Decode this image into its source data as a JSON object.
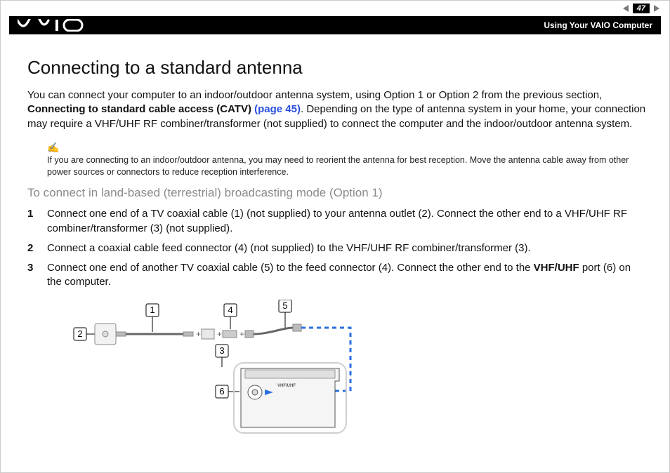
{
  "header": {
    "section": "Using Your VAIO Computer",
    "page_number": "47"
  },
  "nav": {
    "prev_icon": "triangle-left",
    "next_icon": "triangle-right"
  },
  "title": "Connecting to a standard antenna",
  "intro": {
    "t1": "You can connect your computer to an indoor/outdoor antenna system, using Option 1 or Option 2 from the previous section, ",
    "bold": "Connecting to standard cable access (CATV) ",
    "link": "(page 45)",
    "t2": ". Depending on the type of antenna system in your home, your connection may require a VHF/UHF RF combiner/transformer (not supplied) to connect the computer and the indoor/outdoor antenna system."
  },
  "note": {
    "icon": "pen-icon",
    "text": "If you are connecting to an indoor/outdoor antenna, you may need to reorient the antenna for best reception. Move the antenna cable away from other power sources or connectors to reduce reception interference."
  },
  "subheading": "To connect in land-based (terrestrial) broadcasting mode (Option 1)",
  "steps": [
    {
      "n": "1",
      "text": "Connect one end of a TV coaxial cable (1) (not supplied) to your antenna outlet (2). Connect the other end to a VHF/UHF RF combiner/transformer (3) (not supplied)."
    },
    {
      "n": "2",
      "text": "Connect a coaxial cable feed connector (4) (not supplied) to the VHF/UHF RF combiner/transformer (3)."
    },
    {
      "n": "3",
      "a": "Connect one end of another TV coaxial cable (5) to the feed connector (4). Connect the other end to the ",
      "b": "VHF/UHF",
      "c": " port (6) on the computer."
    }
  ],
  "diagram": {
    "labels": [
      "1",
      "2",
      "3",
      "4",
      "5",
      "6"
    ],
    "port_label": "VHF/UHF"
  }
}
